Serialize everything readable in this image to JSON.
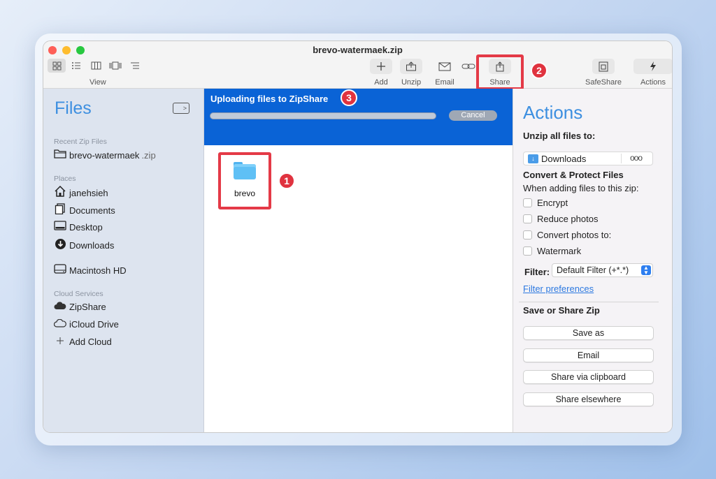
{
  "window": {
    "title": "brevo-watermaek.zip",
    "traffic_colors": [
      "#fe5f57",
      "#febc2e",
      "#28c840"
    ]
  },
  "toolbar": {
    "view_label": "View",
    "view_icons": [
      "grid-view-icon",
      "list-view-icon",
      "column-view-icon",
      "gallery-view-icon",
      "outline-view-icon"
    ],
    "add_label": "Add",
    "unzip_label": "Unzip",
    "email_label": "Email",
    "link_label": "",
    "share_label": "Share",
    "safeshare_label": "SafeShare",
    "actions_label": "Actions"
  },
  "sidebar": {
    "title": "Files",
    "recent_header": "Recent Zip Files",
    "recent_file": "brevo-watermaek",
    "recent_ext": ".zip",
    "places_header": "Places",
    "places": [
      "janehsieh",
      "Documents",
      "Desktop",
      "Downloads"
    ],
    "drive": "Macintosh HD",
    "cloud_header": "Cloud Services",
    "cloud": [
      "ZipShare",
      "iCloud Drive",
      "Add Cloud"
    ]
  },
  "main": {
    "upload_title": "Uploading files to ZipShare",
    "upload_progress": 0.0,
    "cancel_label": "Cancel",
    "folder_name": "brevo"
  },
  "badges": {
    "one": "1",
    "two": "2",
    "three": "3",
    "color": "#e0333f"
  },
  "actions_panel": {
    "title": "Actions",
    "unzip_heading": "Unzip all files to:",
    "destination": "Downloads",
    "more": "ooo",
    "convert_heading": "Convert & Protect Files",
    "convert_sub": "When adding files to this zip:",
    "options": [
      "Encrypt",
      "Reduce photos",
      "Convert photos to:",
      "Watermark"
    ],
    "filter_label": "Filter:",
    "filter_value": "Default Filter (+*.*)",
    "filter_prefs": "Filter preferences",
    "save_heading": "Save or Share Zip",
    "buttons": [
      "Save as",
      "Email",
      "Share via clipboard",
      "Share elsewhere"
    ]
  }
}
